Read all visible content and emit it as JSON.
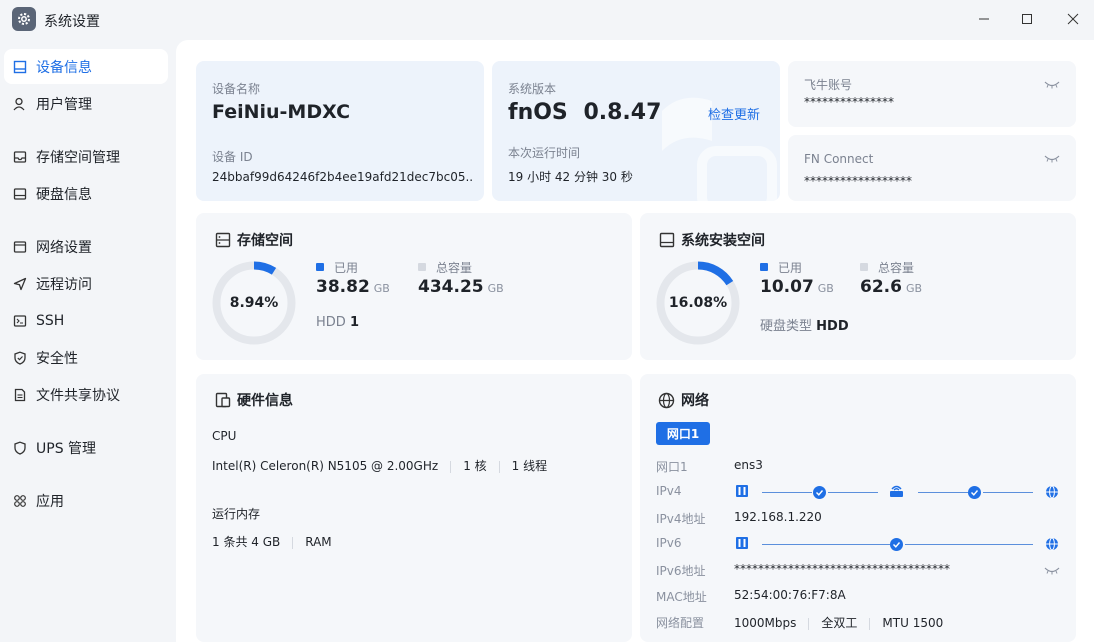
{
  "window": {
    "title": "系统设置"
  },
  "sidebar": {
    "items": [
      {
        "label": "设备信息",
        "icon": "device-info-icon",
        "active": true
      },
      {
        "label": "用户管理",
        "icon": "user-icon"
      },
      {
        "label": "存储空间管理",
        "icon": "storage-icon"
      },
      {
        "label": "硬盘信息",
        "icon": "disk-icon"
      },
      {
        "label": "网络设置",
        "icon": "network-icon"
      },
      {
        "label": "远程访问",
        "icon": "remote-icon"
      },
      {
        "label": "SSH",
        "icon": "ssh-icon"
      },
      {
        "label": "安全性",
        "icon": "shield-icon"
      },
      {
        "label": "文件共享协议",
        "icon": "file-share-icon"
      },
      {
        "label": "UPS 管理",
        "icon": "ups-icon"
      },
      {
        "label": "应用",
        "icon": "apps-icon"
      }
    ]
  },
  "device": {
    "name_label": "设备名称",
    "name": "FeiNiu-MDXC",
    "id_label": "设备 ID",
    "id": "24bbaf99d64246f2b4ee19afd21dec7bc05..."
  },
  "system": {
    "version_label": "系统版本",
    "os": "fnOS",
    "version": "0.8.47",
    "check_update": "检查更新",
    "uptime_label": "本次运行时间",
    "uptime": "19 小时 42 分钟 30 秒"
  },
  "account": {
    "feiniu_label": "飞牛账号",
    "feiniu_value": "***************",
    "fnconnect_label": "FN Connect",
    "fnconnect_value": "******************"
  },
  "storage": {
    "title": "存储空间",
    "percent_text": "8.94%",
    "percent": 8.94,
    "used_label": "已用",
    "used": "38.82",
    "used_unit": "GB",
    "total_label": "总容量",
    "total": "434.25",
    "total_unit": "GB",
    "disk_prefix": "HDD",
    "disk_count": "1"
  },
  "sysdisk": {
    "title": "系统安装空间",
    "percent_text": "16.08%",
    "percent": 16.08,
    "used_label": "已用",
    "used": "10.07",
    "used_unit": "GB",
    "total_label": "总容量",
    "total": "62.6",
    "total_unit": "GB",
    "type_label": "硬盘类型",
    "type": "HDD"
  },
  "hardware": {
    "title": "硬件信息",
    "cpu_label": "CPU",
    "cpu_model": "Intel(R) Celeron(R) N5105 @ 2.00GHz",
    "cpu_cores": "1 核",
    "cpu_threads": "1 线程",
    "mem_label": "运行内存",
    "mem_size": "1 条共 4 GB",
    "mem_type": "RAM"
  },
  "network": {
    "title": "网络",
    "tab": "网口1",
    "rows": {
      "port_label": "网口1",
      "port": "ens3",
      "ipv4_label": "IPv4",
      "ipv4_addr_label": "IPv4地址",
      "ipv4_addr": "192.168.1.220",
      "ipv6_label": "IPv6",
      "ipv6_addr_label": "IPv6地址",
      "ipv6_addr": "************************************",
      "mac_label": "MAC地址",
      "mac": "52:54:00:76:F7:8A",
      "config_label": "网络配置",
      "speed": "1000Mbps",
      "duplex": "全双工",
      "mtu": "MTU 1500"
    }
  },
  "colors": {
    "accent": "#1f6fe5",
    "track": "#e4e7ec",
    "legend_total": "#d5d9e0"
  }
}
